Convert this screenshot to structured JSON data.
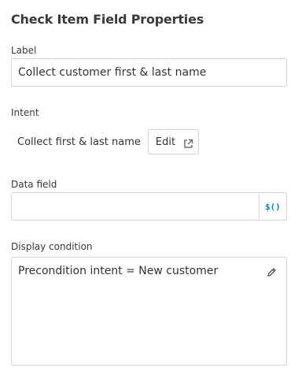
{
  "panel": {
    "title": "Check Item Field Properties"
  },
  "label_field": {
    "label": "Label",
    "value": "Collect customer first & last name"
  },
  "intent": {
    "label": "Intent",
    "value": "Collect first & last name",
    "edit_label": "Edit",
    "edit_icon": "external-link-icon"
  },
  "data_field": {
    "label": "Data field",
    "value": "",
    "expression_button": "$()"
  },
  "display_condition": {
    "label": "Display condition",
    "value": "Precondition intent = New customer",
    "edit_icon": "pencil-icon"
  },
  "colors": {
    "accent": "#1a7fa8",
    "border": "#d6d6d6",
    "text": "#333333"
  }
}
